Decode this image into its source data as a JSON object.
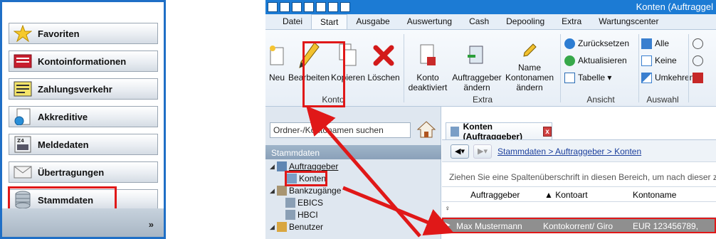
{
  "nav": {
    "items": [
      {
        "label": "Favoriten",
        "icon": "star-icon"
      },
      {
        "label": "Kontoinformationen",
        "icon": "account-info-icon"
      },
      {
        "label": "Zahlungsverkehr",
        "icon": "payments-icon"
      },
      {
        "label": "Akkreditive",
        "icon": "letter-of-credit-icon"
      },
      {
        "label": "Meldedaten",
        "icon": "report-data-icon"
      },
      {
        "label": "Übertragungen",
        "icon": "envelope-icon"
      },
      {
        "label": "Stammdaten",
        "icon": "database-icon"
      }
    ],
    "more": "»"
  },
  "app": {
    "title": "Konten (Auftraggel",
    "menu": [
      "Datei",
      "Start",
      "Ausgabe",
      "Auswertung",
      "Cash",
      "Depooling",
      "Extra",
      "Wartungscenter"
    ],
    "active_menu": "Start",
    "ribbon": {
      "new": "Neu",
      "edit": "Bearbeiten",
      "copy": "Kopieren",
      "delete": "Löschen",
      "group_konto": "Konto",
      "deactivated_1": "Konto",
      "deactivated_2": "deaktiviert",
      "change_client_1": "Auftraggeber",
      "change_client_2": "ändern",
      "change_names_1": "Kontonamen",
      "change_names_2": "ändern",
      "name": "Name",
      "group_extra": "Extra",
      "reset": "Zurücksetzen",
      "refresh": "Aktualisieren",
      "table": "Tabelle ▾",
      "group_view": "Ansicht",
      "all": "Alle",
      "none": "Keine",
      "invert": "Umkehren",
      "group_select": "Auswahl"
    },
    "folders": {
      "search_placeholder": "Ordner-/Kontonamen suchen",
      "section": "Stammdaten",
      "tree": [
        "Auftraggeber",
        "Konten",
        "Bankzugänge",
        "EBICS",
        "HBCI",
        "Benutzer"
      ]
    },
    "content": {
      "tab": "Konten (Auftraggeber)",
      "tab_close": "x",
      "breadcrumb": "Stammdaten > Auftraggeber > Konten",
      "group_hint": "Ziehen Sie eine Spaltenüberschrift in diesen Bereich, um nach dieser zu gruppiere",
      "columns": [
        "Auftraggeber",
        "▲ Kontoart",
        "Kontoname"
      ],
      "row": [
        "Max Mustermann",
        "Kontokorrent/ Giro",
        "EUR 123456789,"
      ]
    }
  }
}
